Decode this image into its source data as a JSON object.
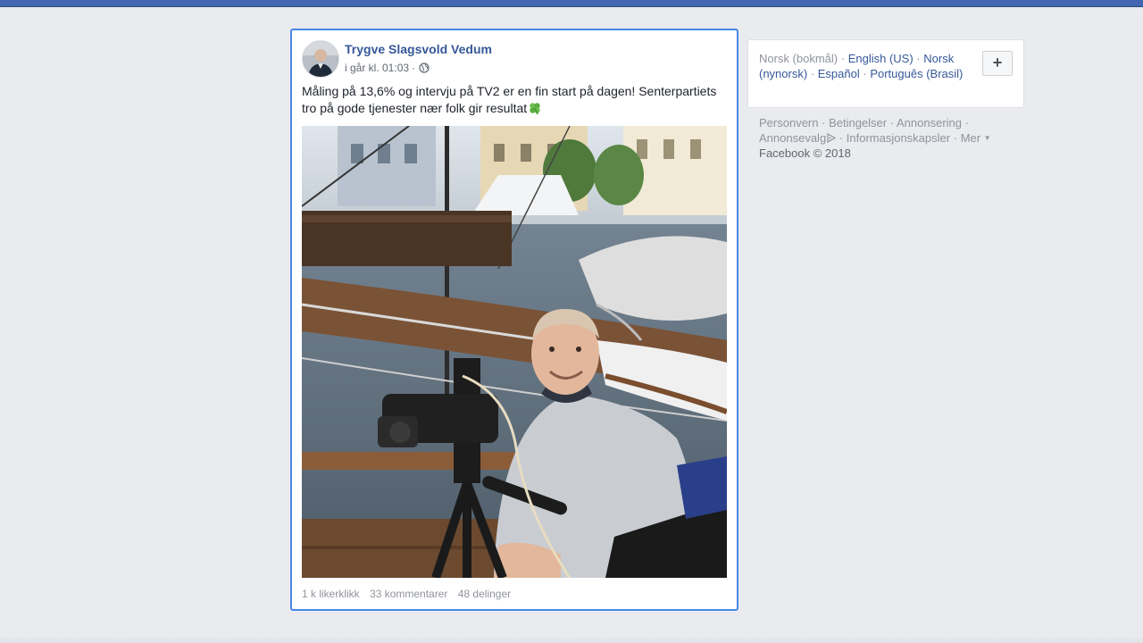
{
  "post": {
    "author": "Trygve Slagsvold Vedum",
    "time": "i går kl. 01:03",
    "meta_separator": "·",
    "privacy_icon": "globe-icon",
    "text": "Måling på 13,6% og intervju på TV2 er en fin start på dagen! Senterpartiets tro på gode tjenester nær folk gir resultat",
    "emoji": "four-leaf-clover-icon",
    "stats": {
      "likes": "1 k likerklikk",
      "comments": "33 kommentarer",
      "shares": "48 delinger"
    }
  },
  "languages": {
    "current": "Norsk (bokmål)",
    "items": [
      "English (US)",
      "Norsk (nynorsk)",
      "Español",
      "Português (Brasil)"
    ],
    "add_button": "+"
  },
  "footer": {
    "links": [
      "Personvern",
      "Betingelser",
      "Annonsering",
      "Annonsevalg",
      "Informasjonskapsler",
      "Mer"
    ],
    "separator": "·",
    "copyright": "Facebook © 2018"
  },
  "colors": {
    "brand": "#4267b2",
    "link": "#365899",
    "selection_border": "#4a86e8",
    "background": "#e9ebee"
  }
}
